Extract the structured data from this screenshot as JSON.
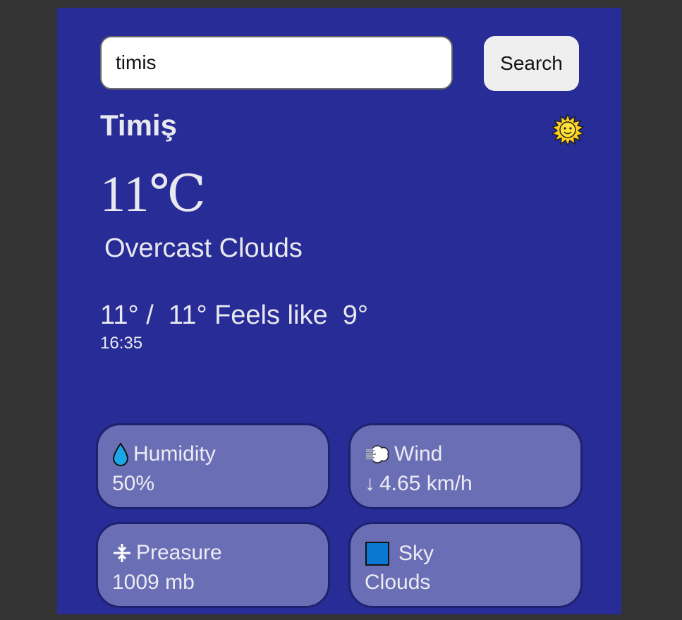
{
  "search": {
    "value": "timis",
    "button_label": "Search"
  },
  "weather": {
    "city": "Timiş",
    "icon": "sun-with-face-icon",
    "temperature": "11℃",
    "description": "Overcast Clouds",
    "minmax": "11° /  11° Feels like  9°",
    "time": "16:35"
  },
  "details": {
    "humidity": {
      "label": "Humidity",
      "value": "50%",
      "icon": "droplet-icon"
    },
    "wind": {
      "label": "Wind",
      "value": "4.65 km/h",
      "direction_arrow": "↓",
      "icon": "wind-icon"
    },
    "pressure": {
      "label": "Preasure",
      "value": "1009 mb",
      "icon": "pressure-icon"
    },
    "sky": {
      "label": "Sky",
      "value": "Clouds",
      "icon": "blue-square-icon"
    }
  },
  "colors": {
    "card_background": "#282c96",
    "tile_background": "#6a6fb5",
    "page_background": "#333333"
  }
}
